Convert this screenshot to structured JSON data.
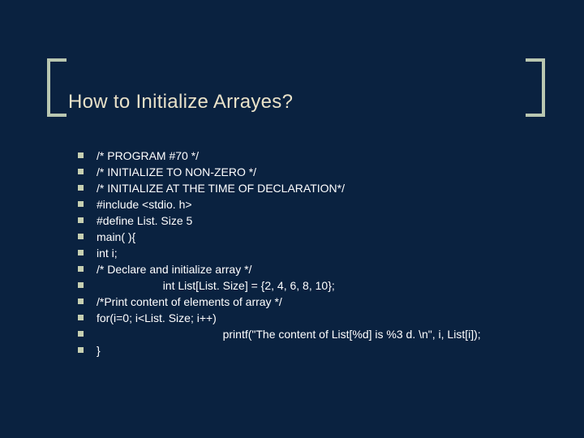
{
  "colors": {
    "background": "#0a2240",
    "title": "#e9e2c9",
    "bracket": "#b9c7b1",
    "bullet": "#c7d0b2",
    "body_text": "#ffffff"
  },
  "title": "How to Initialize Arrayes?",
  "lines": [
    "/* PROGRAM #70 */",
    "/* INITIALIZE TO NON-ZERO */",
    "/* INITIALIZE AT THE TIME OF DECLARATION*/",
    "#include <stdio. h>",
    "#define List. Size 5",
    "main( ){",
    "int i;",
    "/* Declare and initialize array */",
    "                     int List[List. Size] = {2, 4, 6, 8, 10};",
    "/*Print content of elements of array */",
    "for(i=0; i<List. Size; i++)",
    "                                        printf(\"The content of List[%d] is %3 d. \\n\", i, List[i]);",
    "}"
  ]
}
